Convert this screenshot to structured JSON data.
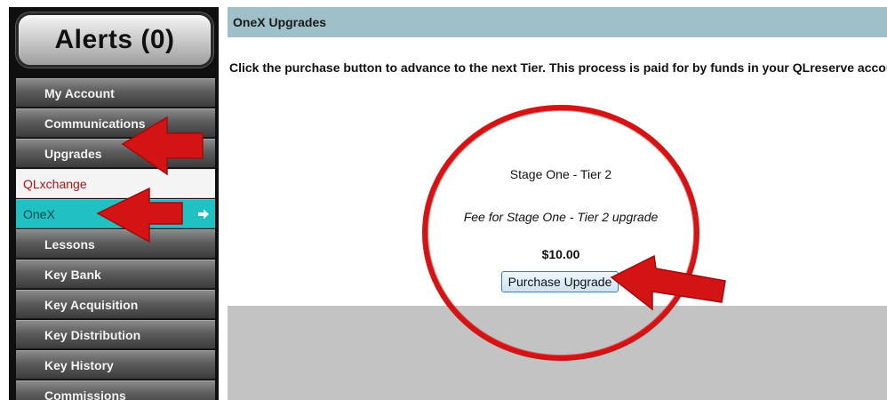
{
  "sidebar": {
    "alerts_label": "Alerts (0)",
    "items": [
      {
        "label": "My Account"
      },
      {
        "label": "Communications"
      },
      {
        "label": "Upgrades"
      },
      {
        "label": "QLxchange"
      },
      {
        "label": "OneX"
      },
      {
        "label": "Lessons"
      },
      {
        "label": "Key Bank"
      },
      {
        "label": "Key Acquisition"
      },
      {
        "label": "Key Distribution"
      },
      {
        "label": "Key History"
      },
      {
        "label": "Commissions"
      }
    ],
    "active_item_arrow_icon": "arrow-right-icon"
  },
  "panel": {
    "title": "OneX Upgrades",
    "intro": "Click the purchase button to advance to the next Tier. This process is paid for by funds in your QLreserve account.",
    "tier_title": "Stage One - Tier 2",
    "fee_description": "Fee for Stage One - Tier 2 upgrade",
    "price": "$10.00",
    "purchase_label": "Purchase Upgrade"
  },
  "annotations": {
    "color": "#d41414",
    "arrows": [
      "upgrades-pointer-arrow",
      "onex-pointer-arrow",
      "purchase-pointer-arrow"
    ],
    "highlight": "circle-highlight"
  },
  "colors": {
    "header_bar": "#9fc0c8",
    "active_item": "#20c0c3",
    "qlxchange_text": "#b1141a",
    "sidebar_bg": "#0f0f0f"
  }
}
